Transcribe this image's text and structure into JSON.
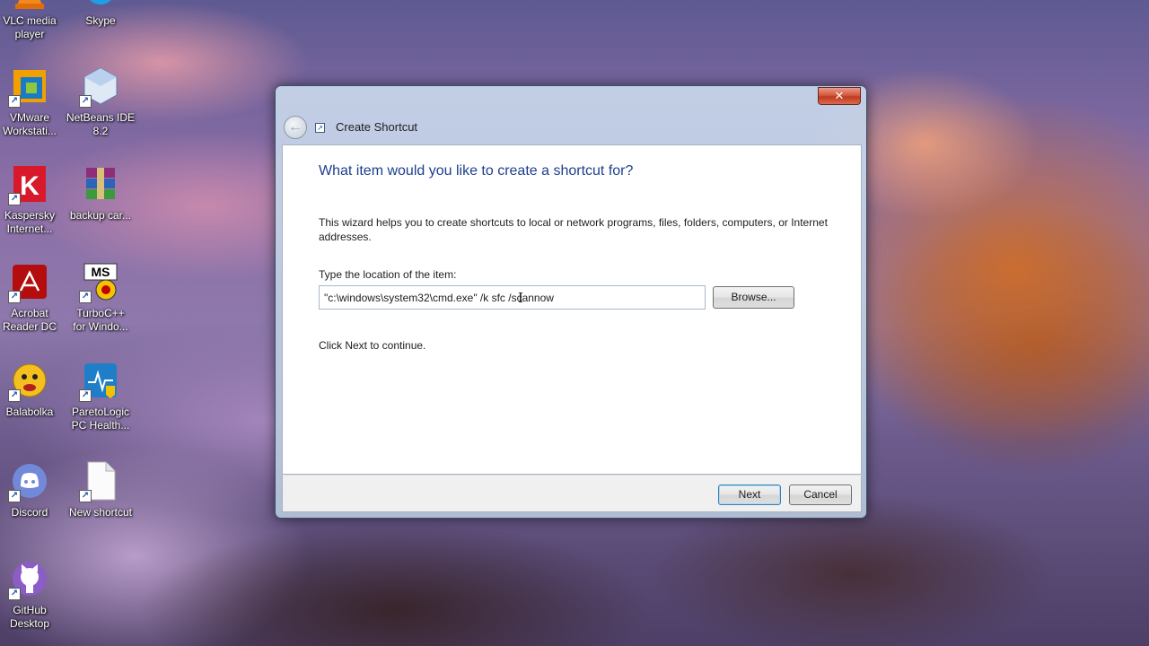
{
  "desktop": {
    "icons": [
      {
        "label": "VLC media\nplayer",
        "icon": "vlc-icon"
      },
      {
        "label": "Skype",
        "icon": "skype-icon"
      },
      {
        "label": "VMware\nWorkstati...",
        "icon": "vmware-icon"
      },
      {
        "label": "NetBeans IDE\n8.2",
        "icon": "netbeans-icon"
      },
      {
        "label": "Kaspersky\nInternet...",
        "icon": "kaspersky-icon"
      },
      {
        "label": "backup car...",
        "icon": "winrar-archive-icon"
      },
      {
        "label": "Acrobat\nReader DC",
        "icon": "acrobat-reader-icon"
      },
      {
        "label": "TurboC++\nfor Windo...",
        "icon": "turbo-cpp-icon"
      },
      {
        "label": "Balabolka",
        "icon": "balabolka-icon"
      },
      {
        "label": "ParetoLogic\nPC Health...",
        "icon": "paretologic-icon"
      },
      {
        "label": "Discord",
        "icon": "discord-icon"
      },
      {
        "label": "New shortcut",
        "icon": "blank-file-icon"
      },
      {
        "label": "GitHub\nDesktop",
        "icon": "github-icon"
      }
    ]
  },
  "dialog": {
    "title": "Create Shortcut",
    "close_glyph": "✕",
    "back_glyph": "←",
    "heading": "What item would you like to create a shortcut for?",
    "description": "This wizard helps you to create shortcuts to local or network programs, files, folders, computers, or Internet addresses.",
    "location_label": "Type the location of the item:",
    "location_value": "\"c:\\windows\\system32\\cmd.exe\" /k sfc /scannow",
    "browse_label": "Browse...",
    "hint": "Click Next to continue.",
    "next_label": "Next",
    "cancel_label": "Cancel"
  },
  "colors": {
    "heading": "#1d3f8c",
    "close_button": "#c0391f"
  }
}
